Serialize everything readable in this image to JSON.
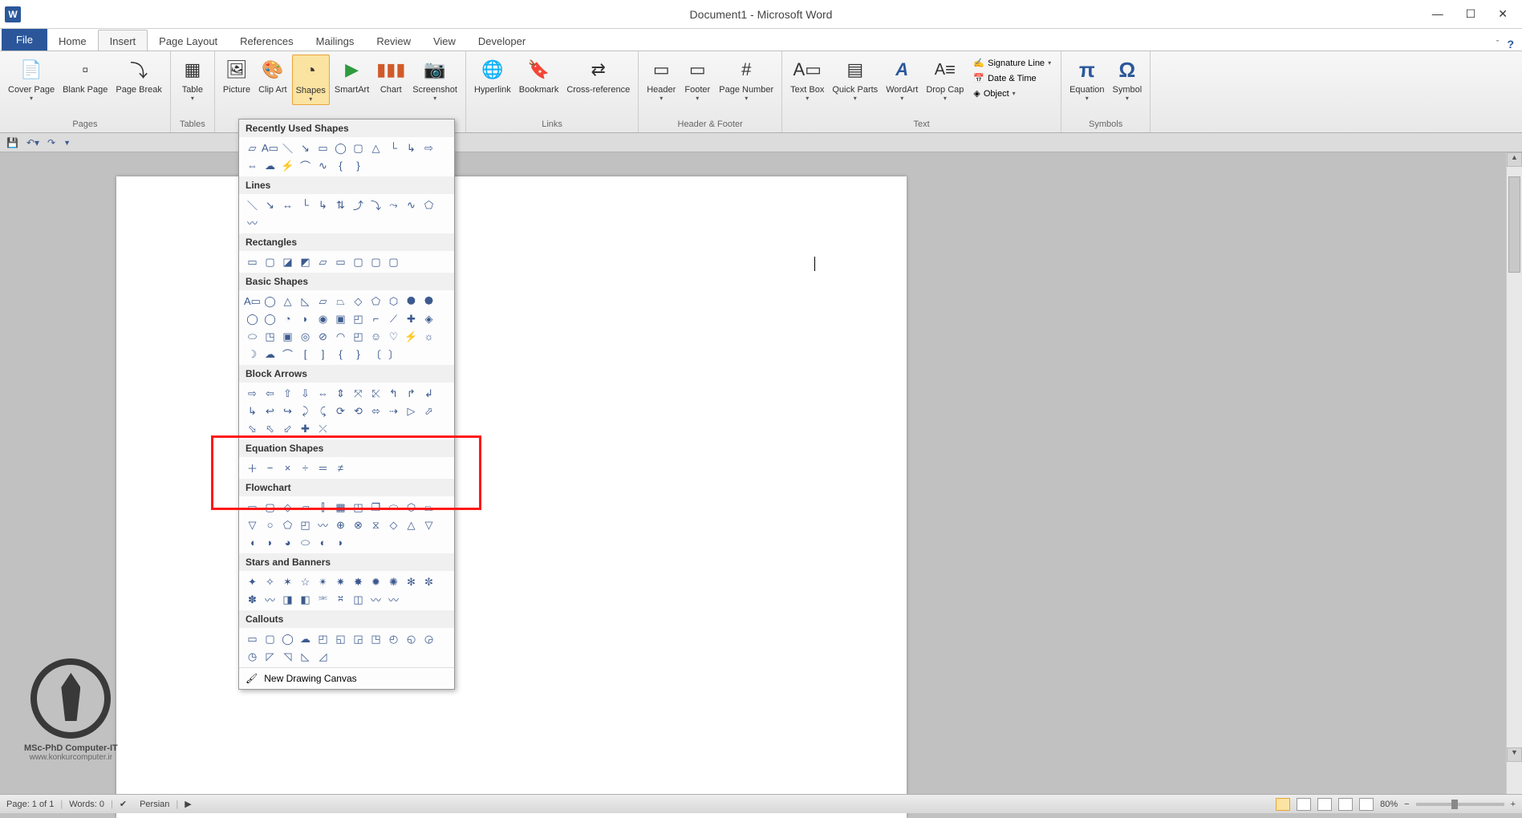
{
  "title": "Document1 - Microsoft Word",
  "tabs": [
    "File",
    "Home",
    "Insert",
    "Page Layout",
    "References",
    "Mailings",
    "Review",
    "View",
    "Developer"
  ],
  "active_tab": "Insert",
  "ribbon": {
    "pages": {
      "label": "Pages",
      "cover": "Cover Page",
      "blank": "Blank Page",
      "break": "Page Break"
    },
    "tables": {
      "label": "Tables",
      "table": "Table"
    },
    "illustrations": {
      "picture": "Picture",
      "clipart": "Clip Art",
      "shapes": "Shapes",
      "smartart": "SmartArt",
      "chart": "Chart",
      "screenshot": "Screenshot"
    },
    "links": {
      "label": "Links",
      "hyperlink": "Hyperlink",
      "bookmark": "Bookmark",
      "crossref": "Cross-reference"
    },
    "headerfooter": {
      "label": "Header & Footer",
      "header": "Header",
      "footer": "Footer",
      "pagenum": "Page Number"
    },
    "text": {
      "label": "Text",
      "textbox": "Text Box",
      "quickparts": "Quick Parts",
      "wordart": "WordArt",
      "dropcap": "Drop Cap",
      "sigline": "Signature Line",
      "datetime": "Date & Time",
      "object": "Object"
    },
    "symbols": {
      "label": "Symbols",
      "equation": "Equation",
      "symbol": "Symbol"
    }
  },
  "shapes_menu": {
    "recently_used": "Recently Used Shapes",
    "lines": "Lines",
    "rectangles": "Rectangles",
    "basic": "Basic Shapes",
    "block_arrows": "Block Arrows",
    "equation": "Equation Shapes",
    "flowchart": "Flowchart",
    "stars": "Stars and Banners",
    "callouts": "Callouts",
    "new_canvas": "New Drawing Canvas"
  },
  "status": {
    "page": "Page: 1 of 1",
    "words": "Words: 0",
    "lang": "Persian",
    "zoom": "80%"
  },
  "watermark": {
    "line1": "MSc-PhD Computer-IT",
    "line2": "www.konkurcomputer.ir"
  }
}
